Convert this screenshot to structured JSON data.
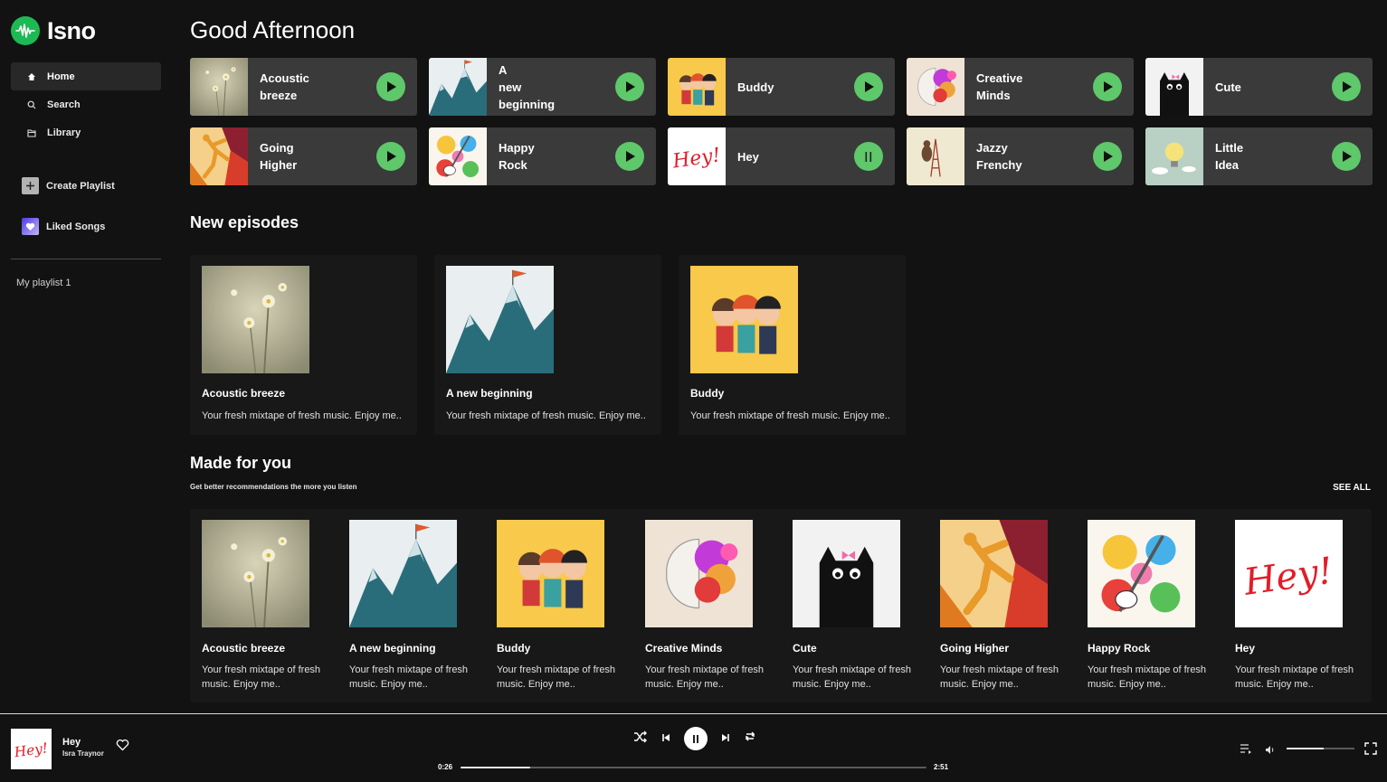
{
  "app": {
    "name": "Isno",
    "accent": "#1db954",
    "play_green": "#5ec86b"
  },
  "sidebar": {
    "nav": [
      {
        "label": "Home",
        "icon": "home-icon",
        "active": true
      },
      {
        "label": "Search",
        "icon": "search-icon",
        "active": false
      },
      {
        "label": "Library",
        "icon": "library-icon",
        "active": false
      }
    ],
    "create_playlist": "Create Playlist",
    "liked_songs": "Liked Songs",
    "playlists": [
      "My playlist 1"
    ]
  },
  "main": {
    "greeting": "Good Afternoon",
    "quick_picks": [
      {
        "title": "Acoustic breeze",
        "art": "flowers",
        "state": "play"
      },
      {
        "title": "A new beginning",
        "art": "mountains",
        "state": "play"
      },
      {
        "title": "Buddy",
        "art": "buddy",
        "state": "play"
      },
      {
        "title": "Creative Minds",
        "art": "brain",
        "state": "play"
      },
      {
        "title": "Cute",
        "art": "cat",
        "state": "play"
      },
      {
        "title": "Going Higher",
        "art": "jump",
        "state": "play"
      },
      {
        "title": "Happy Rock",
        "art": "guitar",
        "state": "play"
      },
      {
        "title": "Hey",
        "art": "hey",
        "state": "pause"
      },
      {
        "title": "Jazzy Frenchy",
        "art": "eiffel",
        "state": "play"
      },
      {
        "title": "Little Idea",
        "art": "bulb",
        "state": "play"
      }
    ],
    "new_episodes": {
      "title": "New episodes",
      "items": [
        {
          "title": "Acoustic breeze",
          "desc": "Your fresh mixtape of fresh music. Enjoy me..",
          "art": "flowers"
        },
        {
          "title": "A new beginning",
          "desc": "Your fresh mixtape of fresh music. Enjoy me..",
          "art": "mountains"
        },
        {
          "title": "Buddy",
          "desc": "Your fresh mixtape of fresh music. Enjoy me..",
          "art": "buddy"
        }
      ]
    },
    "made_for_you": {
      "title": "Made for you",
      "subtitle": "Get better recommendations the more you listen",
      "see_all": "SEE ALL",
      "items": [
        {
          "title": "Acoustic breeze",
          "desc": "Your fresh mixtape of fresh music. Enjoy me..",
          "art": "flowers"
        },
        {
          "title": "A new beginning",
          "desc": "Your fresh mixtape of fresh music. Enjoy me..",
          "art": "mountains"
        },
        {
          "title": "Buddy",
          "desc": "Your fresh mixtape of fresh music. Enjoy me..",
          "art": "buddy"
        },
        {
          "title": "Creative Minds",
          "desc": "Your fresh mixtape of fresh music. Enjoy me..",
          "art": "brain"
        },
        {
          "title": "Cute",
          "desc": "Your fresh mixtape of fresh music. Enjoy me..",
          "art": "cat"
        },
        {
          "title": "Going Higher",
          "desc": "Your fresh mixtape of fresh music. Enjoy me..",
          "art": "jump"
        },
        {
          "title": "Happy Rock",
          "desc": "Your fresh mixtape of fresh music. Enjoy me..",
          "art": "guitar"
        },
        {
          "title": "Hey",
          "desc": "Your fresh mixtape of fresh music. Enjoy me..",
          "art": "hey"
        }
      ]
    }
  },
  "player": {
    "title": "Hey",
    "artist": "Isra Traynor",
    "art": "hey",
    "elapsed": "0:26",
    "duration": "2:51",
    "progress": 0.15,
    "volume": 0.55
  }
}
